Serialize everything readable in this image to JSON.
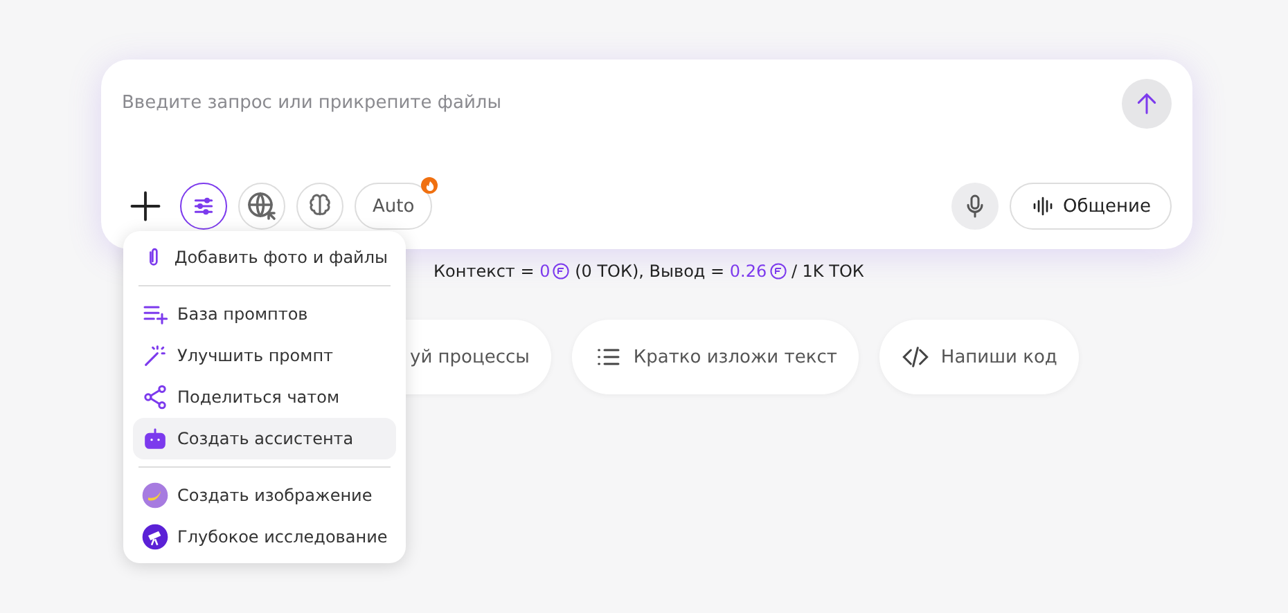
{
  "composer": {
    "placeholder": "Введите запрос или прикрепите файлы",
    "tools": [
      {
        "kind": "plus",
        "selected": false
      },
      {
        "kind": "settings",
        "selected": true
      },
      {
        "kind": "web",
        "selected": false
      },
      {
        "kind": "brain",
        "selected": false
      },
      {
        "kind": "model",
        "label": "Auto",
        "selected": false
      }
    ],
    "voice_label": "Общение"
  },
  "pricing": [
    {
      "text": "Контекст = ",
      "accent": false
    },
    {
      "text": "0",
      "accent": true,
      "coin": true
    },
    {
      "text": " (0 ТОК), Вывод = ",
      "accent": false
    },
    {
      "text": "0.26",
      "accent": true,
      "coin": true
    },
    {
      "text": " / 1K ТОК",
      "accent": false
    }
  ],
  "suggestions": [
    {
      "kind": "plain",
      "label": "уй процессы"
    },
    {
      "kind": "list",
      "label": "Кратко изложи текст"
    },
    {
      "kind": "code",
      "label": "Напиши код"
    }
  ],
  "menu": {
    "groups": [
      [
        {
          "kind": "clip",
          "label": "Добавить фото и файлы",
          "highlighted": false
        }
      ],
      [
        {
          "kind": "list-plus",
          "label": "База промптов",
          "highlighted": false
        },
        {
          "kind": "wand",
          "label": "Улучшить промпт",
          "highlighted": false
        },
        {
          "kind": "share",
          "label": "Поделиться чатом",
          "highlighted": false
        },
        {
          "kind": "robot",
          "label": "Создать ассистента",
          "highlighted": true
        }
      ],
      [
        {
          "kind": "image",
          "label": "Создать изображение",
          "highlighted": false
        },
        {
          "kind": "research",
          "label": "Глубокое исследование",
          "highlighted": false
        }
      ]
    ]
  }
}
